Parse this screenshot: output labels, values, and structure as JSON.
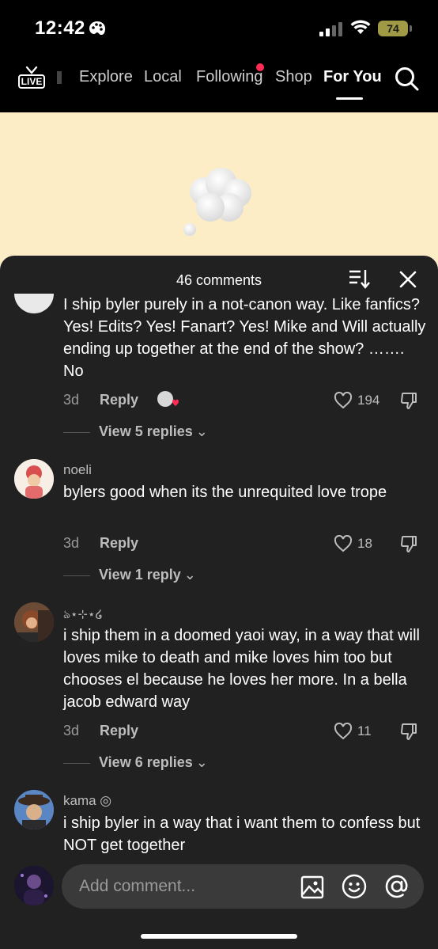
{
  "status": {
    "time": "12:42",
    "battery": "74"
  },
  "nav": {
    "live_label": "LIVE",
    "items": [
      {
        "label": "Explore"
      },
      {
        "label": "Local"
      },
      {
        "label": "Following"
      },
      {
        "label": "Shop"
      },
      {
        "label": "For You"
      }
    ]
  },
  "sheet": {
    "count_label": "46 comments",
    "comments": [
      {
        "username": "",
        "text": "I ship byler purely in a not-canon way. Like fanfics? Yes! Edits? Yes! Fanart? Yes! Mike and Will actually ending up together at the end of the show? ……. No",
        "age": "3d",
        "reply_label": "Reply",
        "likes": "194",
        "view_replies": "View 5 replies"
      },
      {
        "username": "noeli",
        "text": "bylers good when its the unrequited love trope",
        "age": "3d",
        "reply_label": "Reply",
        "likes": "18",
        "view_replies": "View 1 reply"
      },
      {
        "username": "ঌ⋆⊹⋆໒",
        "text": "i ship them in a doomed yaoi way, in a way that will loves mike to death and mike loves him too but chooses el because he loves her more. In a bella jacob edward way",
        "age": "3d",
        "reply_label": "Reply",
        "likes": "11",
        "view_replies": "View 6 replies"
      },
      {
        "username": "kama ◎",
        "text": "i ship byler in a way that i want them to confess but NOT get together"
      }
    ]
  },
  "composer": {
    "placeholder": "Add comment..."
  },
  "colors": {
    "accent_dot": "#ff2b55",
    "sheet_bg": "#212121",
    "video_bg": "#fdedc7"
  }
}
